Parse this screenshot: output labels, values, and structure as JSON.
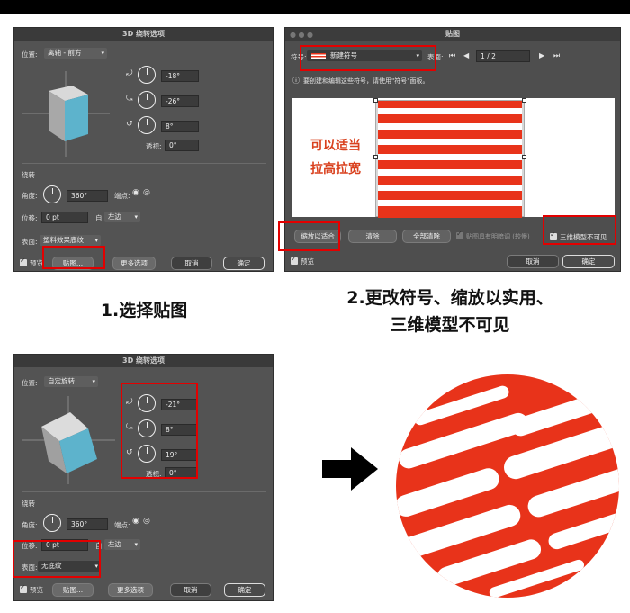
{
  "panel1": {
    "title": "3D 绕转选项",
    "position_label": "位置:",
    "position_value": "离轴 - 前方",
    "angle_x": "-18°",
    "angle_y": "-26°",
    "angle_z": "8°",
    "perspective_label": "透视:",
    "perspective_value": "0°",
    "revolve_label": "绕转",
    "angle_label": "角度:",
    "angle_value": "360°",
    "cap_label": "端点:",
    "offset_label": "位移:",
    "offset_value": "0 pt",
    "from_label": "自",
    "from_value": "左边",
    "surface_label": "表面:",
    "surface_value": "塑料效果底纹",
    "preview_label": "预览",
    "map_art_button": "贴图...",
    "more_options_button": "更多选项",
    "cancel_button": "取消",
    "ok_button": "确定"
  },
  "panel2": {
    "title": "贴图",
    "symbol_label": "符号:",
    "symbol_value": "新建符号",
    "surface_label": "表面:",
    "surface_value": "1 / 2",
    "info_text": "要创建和编辑这些符号，请使用\"符号\"面板。",
    "annotation_line1": "可以适当",
    "annotation_line2": "拉高拉宽",
    "scale_to_fit_button": "缩放以适合",
    "clear_button": "清除",
    "clear_all_button": "全部清除",
    "shade_artwork_label": "贴图具有明暗调 (较慢)",
    "invisible_geometry_label": "三维模型不可见",
    "preview_label": "预览",
    "cancel_button": "取消",
    "ok_button": "确定"
  },
  "panel3": {
    "title": "3D 绕转选项",
    "position_label": "位置:",
    "position_value": "自定旋转",
    "angle_x": "-21°",
    "angle_y": "8°",
    "angle_z": "19°",
    "perspective_label": "透视:",
    "perspective_value": "0°",
    "revolve_label": "绕转",
    "angle_label": "角度:",
    "angle_value": "360°",
    "cap_label": "端点:",
    "offset_label": "位移:",
    "offset_value": "0 pt",
    "from_label": "自",
    "from_value": "左边",
    "surface_label": "表面:",
    "surface_value": "无底纹",
    "preview_label": "预览",
    "map_art_button": "贴图...",
    "more_options_button": "更多选项",
    "cancel_button": "取消",
    "ok_button": "确定"
  },
  "captions": {
    "step1": "1.选择贴图",
    "step2_line1": "2.更改符号、缩放以实用、",
    "step2_line2": "三维模型不可见"
  },
  "colors": {
    "accent_red": "#e30000",
    "ball_red": "#e8331a",
    "cube_blue": "#5db3cc"
  }
}
